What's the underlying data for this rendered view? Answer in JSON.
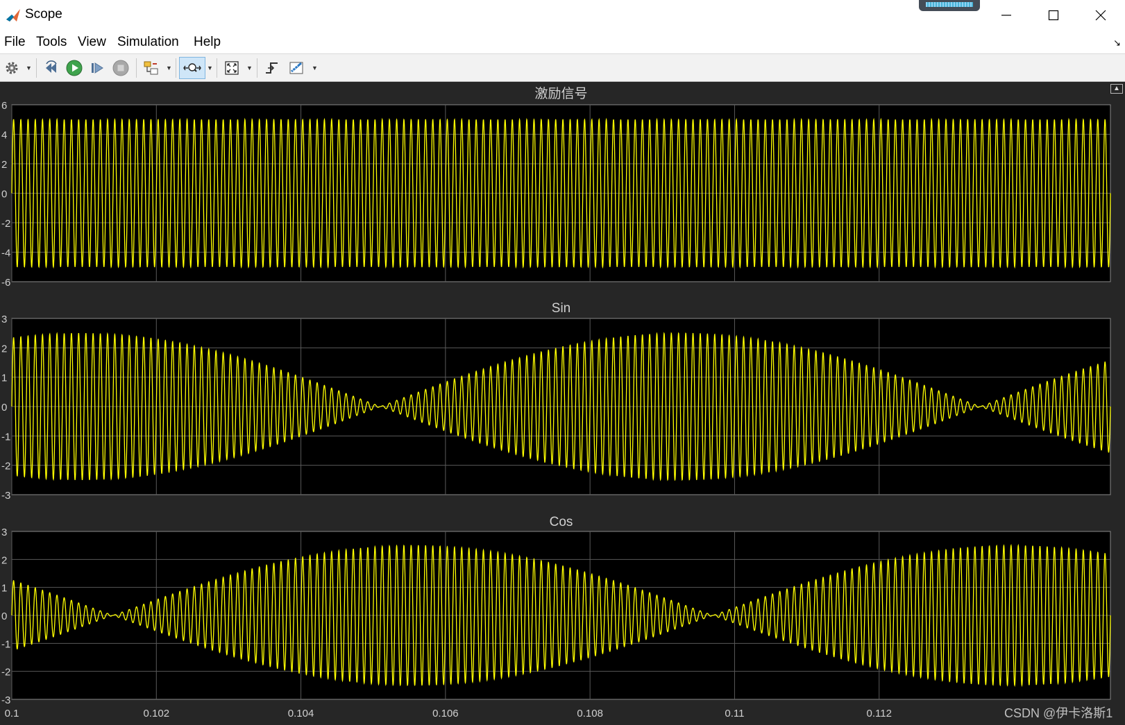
{
  "window": {
    "title": "Scope",
    "controls": [
      "minimize-icon",
      "maximize-icon",
      "close-icon"
    ]
  },
  "menu": [
    "File",
    "Tools",
    "View",
    "Simulation",
    "Help"
  ],
  "toolbar": {
    "buttons": [
      "gear-icon",
      "step-back-icon",
      "run-icon",
      "step-forward-icon",
      "stop-icon",
      "highlight-block-icon",
      "zoom-icon",
      "autoscale-icon",
      "triggers-icon",
      "measurements-icon"
    ]
  },
  "colors": {
    "trace": "#ffff00",
    "axes_bg": "#000000",
    "figure_bg": "#262626",
    "grid": "#5a5a5a",
    "axis_text": "#d0d0d0"
  },
  "x_ticks": [
    "0.1",
    "0.102",
    "0.104",
    "0.106",
    "0.108",
    "0.11",
    "0.112"
  ],
  "chart_data": [
    {
      "type": "line",
      "title": "激励信号",
      "xlim": [
        0.1,
        0.1152
      ],
      "ylim": [
        -6,
        6
      ],
      "yticks": [
        "6",
        "4",
        "2",
        "0",
        "-2",
        "-4",
        "-6"
      ],
      "grid": true,
      "series": [
        {
          "signal": "constant-amplitude sine",
          "amplitude": 5,
          "cycles_in_view": 152
        }
      ]
    },
    {
      "type": "line",
      "title": "Sin",
      "xlim": [
        0.1,
        0.1152
      ],
      "ylim": [
        -3,
        3
      ],
      "yticks": [
        "3",
        "2",
        "1",
        "0",
        "-1",
        "-2",
        "-3"
      ],
      "grid": true,
      "series": [
        {
          "signal": "amplitude-modulated sine",
          "peak_amplitude": 2.5,
          "envelope_period_s": 0.0083,
          "envelope_zero_x": [
            0.1051,
            0.1134
          ],
          "cycles_in_view": 152
        }
      ]
    },
    {
      "type": "line",
      "title": "Cos",
      "xlim": [
        0.1,
        0.1152
      ],
      "ylim": [
        -3,
        3
      ],
      "yticks": [
        "3",
        "2",
        "1",
        "0",
        "-1",
        "-2",
        "-3"
      ],
      "grid": true,
      "series": [
        {
          "signal": "amplitude-modulated sine",
          "peak_amplitude": 2.5,
          "envelope_period_s": 0.0083,
          "envelope_zero_x": [
            0.1014,
            0.1097
          ],
          "cycles_in_view": 152
        }
      ]
    }
  ],
  "watermark": "CSDN @伊卡洛斯1"
}
